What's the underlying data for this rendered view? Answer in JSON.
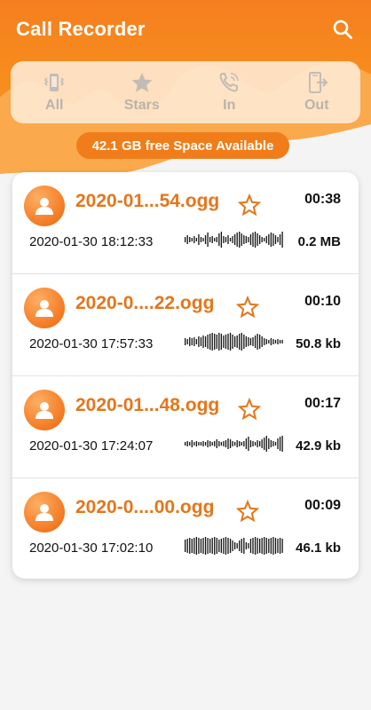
{
  "app_bar": {
    "title": "Call Recorder",
    "search_icon": "search-icon"
  },
  "colors": {
    "brand_orange": "#f57f20",
    "title_orange": "#e4761a",
    "tab_text": "#b9b3ad",
    "badge": "#f07d1a"
  },
  "tabs": [
    {
      "label": "All",
      "icon": "phone-vibrate-icon"
    },
    {
      "label": "Stars",
      "icon": "star-icon"
    },
    {
      "label": "In",
      "icon": "incoming-call-icon"
    },
    {
      "label": "Out",
      "icon": "outgoing-call-icon"
    }
  ],
  "free_space": "42.1 GB free Space Available",
  "recordings": [
    {
      "file": "2020-01...54.ogg",
      "duration": "00:38",
      "timestamp": "2020-01-30 18:12:33",
      "size": "0.2 MB"
    },
    {
      "file": "2020-0....22.ogg",
      "duration": "00:10",
      "timestamp": "2020-01-30 17:57:33",
      "size": "50.8 kb"
    },
    {
      "file": "2020-01...48.ogg",
      "duration": "00:17",
      "timestamp": "2020-01-30 17:24:07",
      "size": "42.9 kb"
    },
    {
      "file": "2020-0....00.ogg",
      "duration": "00:09",
      "timestamp": "2020-01-30 17:02:10",
      "size": "46.1 kb"
    }
  ]
}
